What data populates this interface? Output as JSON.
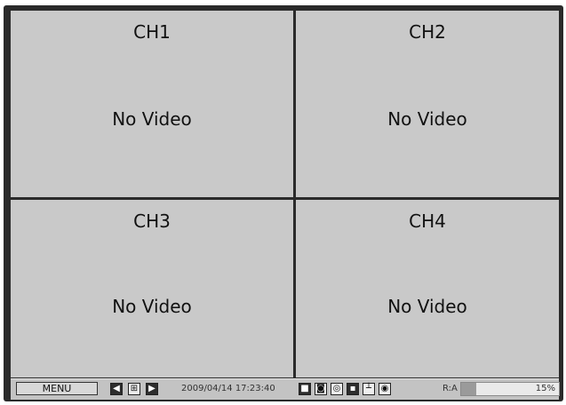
{
  "channels": [
    {
      "label": "CH1",
      "status": "No Video"
    },
    {
      "label": "CH2",
      "status": "No Video"
    },
    {
      "label": "CH3",
      "status": "No Video"
    },
    {
      "label": "CH4",
      "status": "No Video"
    }
  ],
  "toolbar": {
    "menu_label": "MENU",
    "prev_glyph": "◀",
    "grid_glyph": "⊞",
    "next_glyph": "▶",
    "datetime": "2009/04/14 17:23:40",
    "record_label": "R:A",
    "progress_percent": 15,
    "progress_text": "15%",
    "status_icons": [
      "record-icon",
      "schedule-icon",
      "motion-icon",
      "alarm-icon",
      "network-icon",
      "audio-icon"
    ]
  },
  "colors": {
    "tile_bg": "#c9c9c9",
    "divider": "#2a2a2a",
    "toolbar_bg": "#c3c3c3"
  }
}
